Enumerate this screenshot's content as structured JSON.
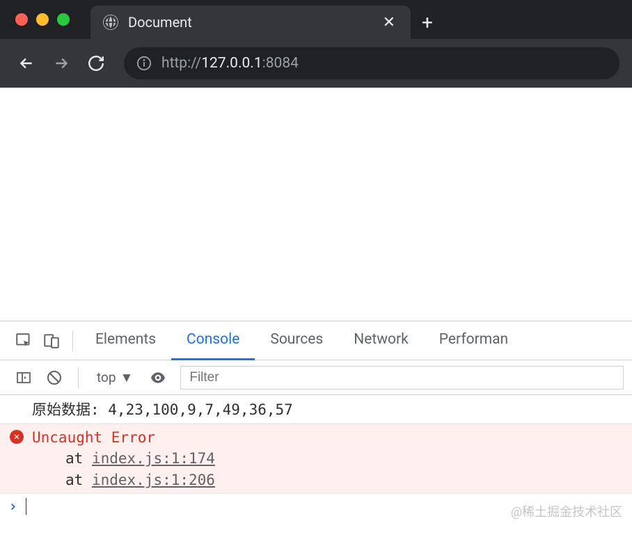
{
  "tab": {
    "title": "Document"
  },
  "url": {
    "protocol": "http://",
    "host": "127.0.0.1",
    "port": ":8084"
  },
  "devtools": {
    "tabs": {
      "elements": "Elements",
      "console": "Console",
      "sources": "Sources",
      "network": "Network",
      "performance": "Performan"
    },
    "toolbar": {
      "context": "top",
      "filter_placeholder": "Filter"
    },
    "console": {
      "log1": "原始数据: 4,23,100,9,7,49,36,57",
      "error_title": "Uncaught Error",
      "stack_at": "at ",
      "stack1_link": "index.js:1:174",
      "stack2_link": "index.js:1:206"
    }
  },
  "watermark": "@稀土掘金技术社区"
}
